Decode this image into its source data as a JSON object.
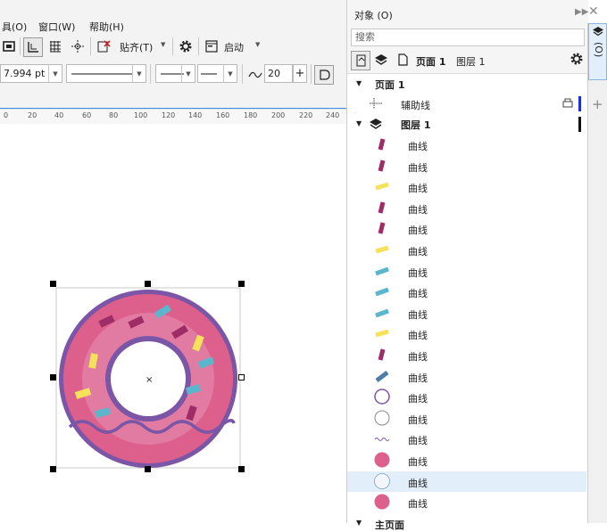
{
  "menu": {
    "items": [
      "具(O)",
      "窗口(W)",
      "帮助(H)"
    ]
  },
  "toolbar": {
    "snap_label": "贴齐(T)",
    "launch_label": "启动"
  },
  "propbar": {
    "outline_width": "7.994 pt",
    "corner_value": "20"
  },
  "ruler": {
    "ticks": [
      "0",
      "20",
      "40",
      "60",
      "80",
      "100",
      "120",
      "140",
      "160",
      "180",
      "200",
      "220",
      "240"
    ]
  },
  "panel": {
    "title": "对象 (O)",
    "search_placeholder": "搜索",
    "page_label": "页面 1",
    "layer_label_toolbar": "图层 1",
    "page_node": "页面 1",
    "guides_node": "辅助线",
    "layer_node": "图层 1",
    "master_page_partial": "主页面",
    "dock_tab": "对象 (O)"
  },
  "objects": [
    {
      "name": "曲线",
      "thumb": "sprinkle-magenta"
    },
    {
      "name": "曲线",
      "thumb": "sprinkle-magenta"
    },
    {
      "name": "曲线",
      "thumb": "sprinkle-yellow"
    },
    {
      "name": "曲线",
      "thumb": "sprinkle-magenta"
    },
    {
      "name": "曲线",
      "thumb": "sprinkle-magenta"
    },
    {
      "name": "曲线",
      "thumb": "sprinkle-yellow"
    },
    {
      "name": "曲线",
      "thumb": "sprinkle-blue"
    },
    {
      "name": "曲线",
      "thumb": "sprinkle-blue"
    },
    {
      "name": "曲线",
      "thumb": "sprinkle-blue"
    },
    {
      "name": "曲线",
      "thumb": "sprinkle-yellow"
    },
    {
      "name": "曲线",
      "thumb": "sprinkle-magenta"
    },
    {
      "name": "曲线",
      "thumb": "sprinkle-steel"
    },
    {
      "name": "曲线",
      "thumb": "ring-purple"
    },
    {
      "name": "曲线",
      "thumb": "ring-gray"
    },
    {
      "name": "曲线",
      "thumb": "wave-purple"
    },
    {
      "name": "曲线",
      "thumb": "disc-pink"
    },
    {
      "name": "曲线",
      "thumb": "circle-light",
      "selected": true
    },
    {
      "name": "曲线",
      "thumb": "disc-pink"
    }
  ],
  "colors": {
    "donut_outline": "#7b55a6",
    "donut_icing": "#dd5f8c",
    "donut_icing_light": "#e27ba2",
    "sprinkle_magenta": "#9e2d67",
    "sprinkle_yellow": "#f5e25a",
    "sprinkle_blue": "#5bb6cc",
    "sprinkle_steel": "#4d7ea8",
    "accent": "#3a8ee6",
    "selection_row": "#e3eefb"
  }
}
